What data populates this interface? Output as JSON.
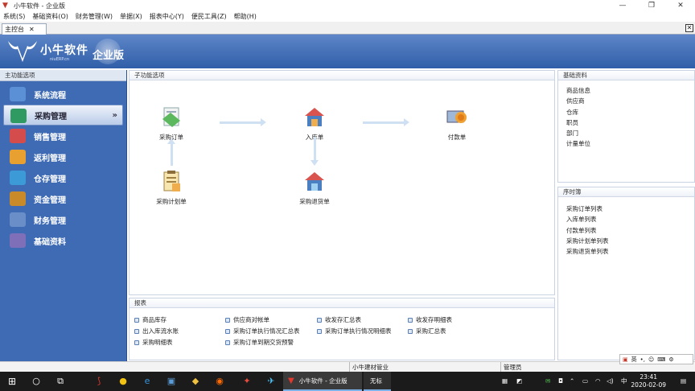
{
  "window": {
    "title": "小牛软件 - 企业版",
    "controls": [
      "—",
      "❐",
      "✕"
    ]
  },
  "menu": [
    "系统(S)",
    "基础资料(O)",
    "财务管理(W)",
    "单据(X)",
    "报表中心(Y)",
    "便民工具(Z)",
    "帮助(H)"
  ],
  "tab": {
    "label": "主控台",
    "close": "✕"
  },
  "banner": {
    "brand": "小牛软件",
    "sub": "niuERP.cn",
    "edition": "企业版"
  },
  "leftnav": {
    "header": "主功能选项",
    "items": [
      {
        "label": "系统流程",
        "color": "#5b8fd6"
      },
      {
        "label": "采购管理",
        "color": "#2f9b63",
        "active": true
      },
      {
        "label": "销售管理",
        "color": "#d44c4c"
      },
      {
        "label": "返利管理",
        "color": "#e8a030"
      },
      {
        "label": "仓存管理",
        "color": "#3c9ad6"
      },
      {
        "label": "资金管理",
        "color": "#c98a2a"
      },
      {
        "label": "财务管理",
        "color": "#6a8fc8"
      },
      {
        "label": "基础资料",
        "color": "#7f6fb8"
      }
    ],
    "chevron": "»"
  },
  "main": {
    "header": "子功能选项",
    "flow": [
      {
        "label": "采购订单",
        "icon": "purchase-order-icon"
      },
      {
        "label": "入库单",
        "icon": "warehouse-in-icon"
      },
      {
        "label": "付款单",
        "icon": "payment-icon"
      },
      {
        "label": "采购计划单",
        "icon": "purchase-plan-icon"
      },
      {
        "label": "采购退货单",
        "icon": "purchase-return-icon"
      }
    ]
  },
  "reports": {
    "header": "报表",
    "items": [
      "商品库存",
      "供应商对帐单",
      "收发存汇总表",
      "收发存明细表",
      "出入库流水账",
      "采购订单执行情况汇总表",
      "采购订单执行情况明细表",
      "采购汇总表",
      "采购明细表",
      "采购订单到期交货预警"
    ]
  },
  "basic": {
    "header": "基础资料",
    "items": [
      "商品信息",
      "供应商",
      "仓库",
      "职员",
      "部门",
      "计量单位"
    ]
  },
  "sequence": {
    "header": "序时簿",
    "items": [
      "采购订单列表",
      "入库单列表",
      "付款单列表",
      "采购计划单列表",
      "采购退货单列表"
    ]
  },
  "status": {
    "company": "小牛建材管业",
    "user": "管理员"
  },
  "ime": {
    "lang": "英"
  },
  "taskbar": {
    "app_label": "小牛软件 - 企业版",
    "app2_label": "无标",
    "time": "23:41",
    "date": "2020-02-09",
    "input_lang": "中"
  }
}
